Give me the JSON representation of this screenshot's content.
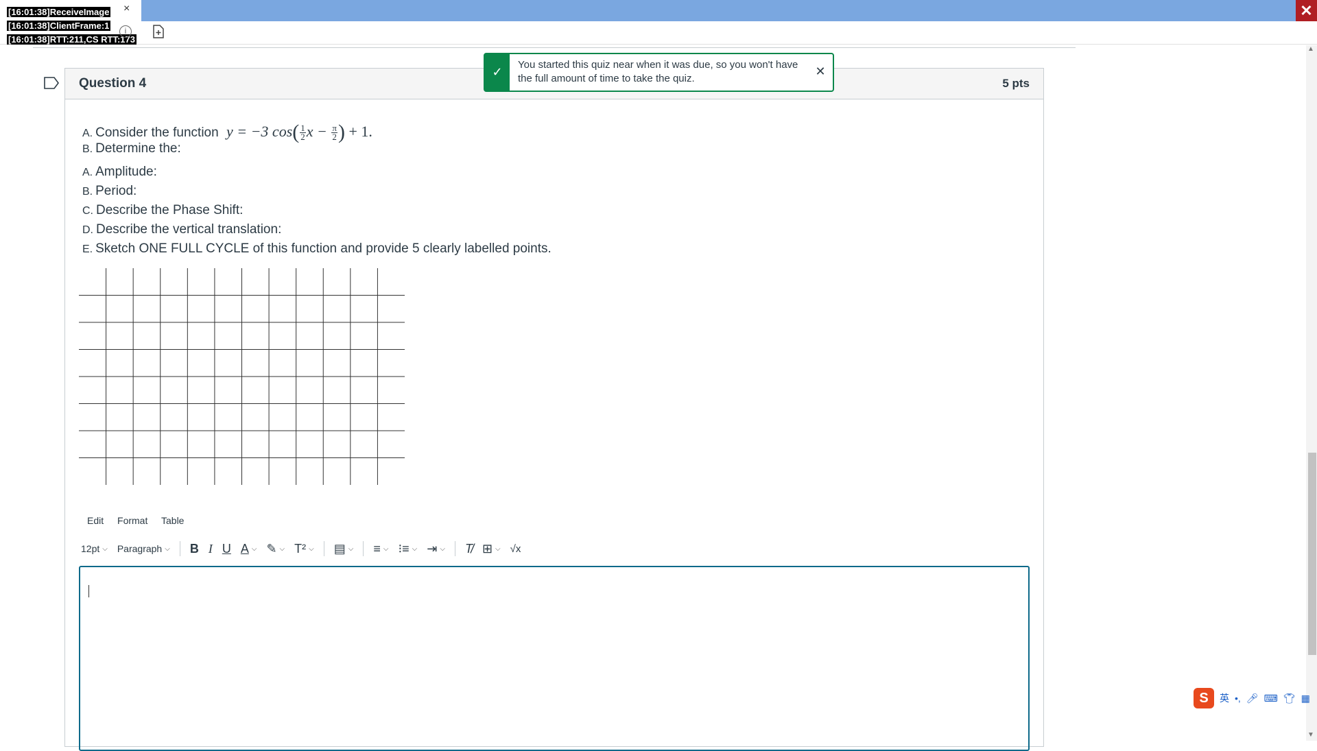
{
  "debug_lines": [
    "[16:01:38]ReceiveImage",
    "[16:01:38]ClientFrame:1",
    "[16:01:38]RTT:211,CS RTT:173"
  ],
  "tab": {
    "close": "×"
  },
  "window": {
    "close": "✕"
  },
  "question": {
    "title": "Question 4",
    "points": "5 pts",
    "items": [
      {
        "marker": "A.",
        "text": "Consider the function"
      },
      {
        "marker": "B.",
        "text": "Determine the:"
      },
      {
        "marker": "A.",
        "text": "Amplitude:"
      },
      {
        "marker": "B.",
        "text": "Period:"
      },
      {
        "marker": "C.",
        "text": "Describe the Phase Shift:"
      },
      {
        "marker": "D.",
        "text": "Describe the vertical translation:"
      },
      {
        "marker": "E.",
        "text": "Sketch ONE FULL CYCLE of this function and provide 5 clearly labelled points."
      }
    ],
    "formula": {
      "lhs": "y = −3 cos",
      "frac1_num": "1",
      "frac1_den": "2",
      "x": "x −",
      "frac2_num": "π",
      "frac2_den": "2",
      "tail": "+ 1."
    }
  },
  "grid": {
    "columns": 12,
    "rows": 8
  },
  "editor": {
    "menu": [
      "Edit",
      "Format",
      "Table"
    ],
    "font_size": "12pt",
    "block_format": "Paragraph",
    "content": ""
  },
  "toast": {
    "message": "You started this quiz near when it was due, so you won't have the full amount of time to take the quiz.",
    "check": "✓",
    "close": "✕"
  },
  "ime": {
    "logo": "S",
    "lang": "英",
    "punct": "•,"
  },
  "colors": {
    "accent": "#0b874b",
    "topbar": "#7aa7e0",
    "editor_border": "#0e6a8a"
  }
}
